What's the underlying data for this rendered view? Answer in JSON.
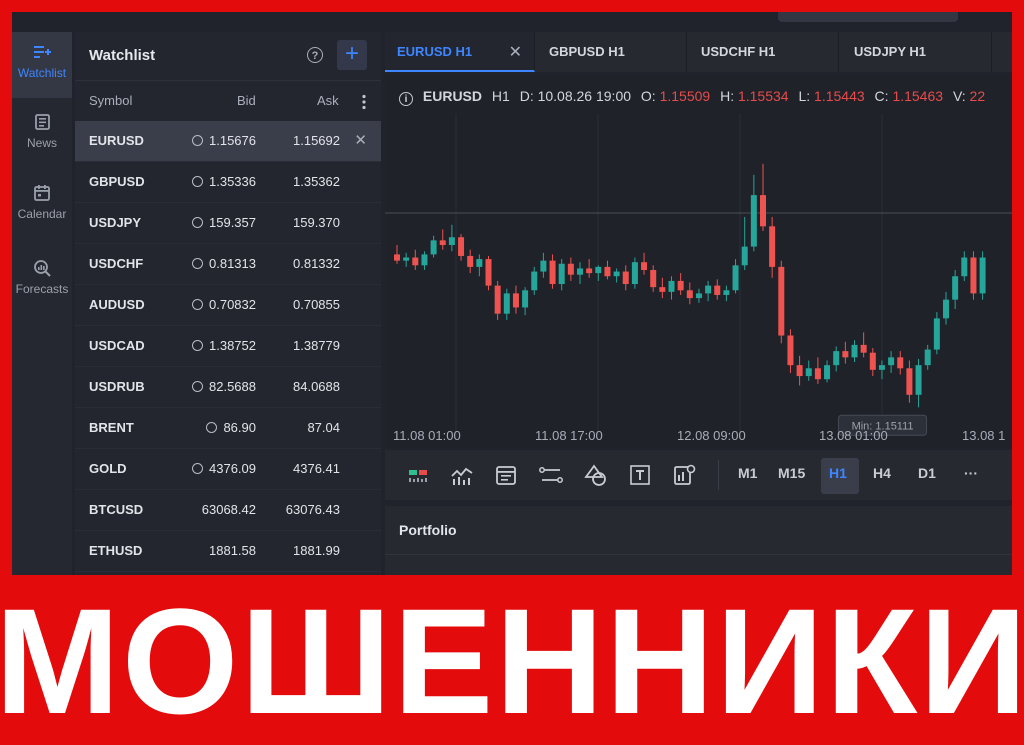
{
  "nav": {
    "items": [
      {
        "label": "Watchlist"
      },
      {
        "label": "News"
      },
      {
        "label": "Calendar"
      },
      {
        "label": "Forecasts"
      }
    ]
  },
  "watchlist": {
    "title": "Watchlist",
    "help_glyph": "?",
    "add_glyph": "+",
    "columns": {
      "symbol": "Symbol",
      "bid": "Bid",
      "ask": "Ask"
    },
    "rows": [
      {
        "symbol": "EURUSD",
        "bid": "1.15676",
        "ask": "1.15692",
        "alarm": true
      },
      {
        "symbol": "GBPUSD",
        "bid": "1.35336",
        "ask": "1.35362",
        "alarm": true
      },
      {
        "symbol": "USDJPY",
        "bid": "159.357",
        "ask": "159.370",
        "alarm": true
      },
      {
        "symbol": "USDCHF",
        "bid": "0.81313",
        "ask": "0.81332",
        "alarm": true
      },
      {
        "symbol": "AUDUSD",
        "bid": "0.70832",
        "ask": "0.70855",
        "alarm": true
      },
      {
        "symbol": "USDCAD",
        "bid": "1.38752",
        "ask": "1.38779",
        "alarm": true
      },
      {
        "symbol": "USDRUB",
        "bid": "82.5688",
        "ask": "84.0688",
        "alarm": true
      },
      {
        "symbol": "BRENT",
        "bid": "86.90",
        "ask": "87.04",
        "alarm": true
      },
      {
        "symbol": "GOLD",
        "bid": "4376.09",
        "ask": "4376.41",
        "alarm": true
      },
      {
        "symbol": "BTCUSD",
        "bid": "63068.42",
        "ask": "63076.43",
        "alarm": false
      },
      {
        "symbol": "ETHUSD",
        "bid": "1881.58",
        "ask": "1881.99",
        "alarm": false
      }
    ]
  },
  "tabs": [
    {
      "label": "EURUSD H1",
      "active": true
    },
    {
      "label": "GBPUSD H1"
    },
    {
      "label": "USDCHF H1"
    },
    {
      "label": "USDJPY H1"
    }
  ],
  "chart_header": {
    "symbol": "EURUSD",
    "timeframe": "H1",
    "date_label": "D:",
    "date": "10.08.26 19:00",
    "open_label": "O:",
    "open": "1.15509",
    "high_label": "H:",
    "high": "1.15534",
    "low_label": "L:",
    "low": "1.15443",
    "close_label": "C:",
    "close": "1.15463",
    "volume_label": "V:",
    "volume": "22"
  },
  "chart_data": {
    "type": "candlestick",
    "x_tick_labels": [
      "11.08 01:00",
      "11.08 17:00",
      "12.08 09:00",
      "13.08 01:00",
      "13.08 1"
    ],
    "annotation": "Min: 1.15111",
    "up_color": "#26a69a",
    "down_color": "#ef5350",
    "grid": true,
    "series": [
      {
        "o": 1.155,
        "h": 1.1556,
        "l": 1.1544,
        "c": 1.1546
      },
      {
        "o": 1.1546,
        "h": 1.1551,
        "l": 1.1542,
        "c": 1.1548
      },
      {
        "o": 1.1548,
        "h": 1.1553,
        "l": 1.154,
        "c": 1.1543
      },
      {
        "o": 1.1543,
        "h": 1.1552,
        "l": 1.154,
        "c": 1.155
      },
      {
        "o": 1.155,
        "h": 1.1562,
        "l": 1.1548,
        "c": 1.1559
      },
      {
        "o": 1.1559,
        "h": 1.1566,
        "l": 1.1553,
        "c": 1.1556
      },
      {
        "o": 1.1556,
        "h": 1.1569,
        "l": 1.1552,
        "c": 1.1561
      },
      {
        "o": 1.1561,
        "h": 1.1563,
        "l": 1.1546,
        "c": 1.1549
      },
      {
        "o": 1.1549,
        "h": 1.1553,
        "l": 1.1538,
        "c": 1.1542
      },
      {
        "o": 1.1542,
        "h": 1.155,
        "l": 1.1536,
        "c": 1.1547
      },
      {
        "o": 1.1547,
        "h": 1.1549,
        "l": 1.1527,
        "c": 1.153
      },
      {
        "o": 1.153,
        "h": 1.1533,
        "l": 1.1508,
        "c": 1.1512
      },
      {
        "o": 1.1512,
        "h": 1.1528,
        "l": 1.1508,
        "c": 1.1525
      },
      {
        "o": 1.1525,
        "h": 1.153,
        "l": 1.1512,
        "c": 1.1516
      },
      {
        "o": 1.1516,
        "h": 1.1529,
        "l": 1.1511,
        "c": 1.1527
      },
      {
        "o": 1.1527,
        "h": 1.1542,
        "l": 1.1524,
        "c": 1.1539
      },
      {
        "o": 1.1539,
        "h": 1.1551,
        "l": 1.1535,
        "c": 1.1546
      },
      {
        "o": 1.1546,
        "h": 1.155,
        "l": 1.1528,
        "c": 1.1531
      },
      {
        "o": 1.1531,
        "h": 1.1547,
        "l": 1.1527,
        "c": 1.1544
      },
      {
        "o": 1.1544,
        "h": 1.1548,
        "l": 1.1533,
        "c": 1.1537
      },
      {
        "o": 1.1537,
        "h": 1.1545,
        "l": 1.1531,
        "c": 1.1541
      },
      {
        "o": 1.1541,
        "h": 1.1547,
        "l": 1.1535,
        "c": 1.1538
      },
      {
        "o": 1.1538,
        "h": 1.1543,
        "l": 1.1533,
        "c": 1.1542
      },
      {
        "o": 1.1542,
        "h": 1.1546,
        "l": 1.1534,
        "c": 1.1536
      },
      {
        "o": 1.1536,
        "h": 1.1541,
        "l": 1.1532,
        "c": 1.1539
      },
      {
        "o": 1.1539,
        "h": 1.1543,
        "l": 1.1527,
        "c": 1.1531
      },
      {
        "o": 1.1531,
        "h": 1.1548,
        "l": 1.1528,
        "c": 1.1545
      },
      {
        "o": 1.1545,
        "h": 1.1551,
        "l": 1.1537,
        "c": 1.154
      },
      {
        "o": 1.154,
        "h": 1.1543,
        "l": 1.1526,
        "c": 1.1529
      },
      {
        "o": 1.1529,
        "h": 1.1535,
        "l": 1.1522,
        "c": 1.1526
      },
      {
        "o": 1.1526,
        "h": 1.1536,
        "l": 1.1521,
        "c": 1.1533
      },
      {
        "o": 1.1533,
        "h": 1.1538,
        "l": 1.1524,
        "c": 1.1527
      },
      {
        "o": 1.1527,
        "h": 1.1532,
        "l": 1.1518,
        "c": 1.1522
      },
      {
        "o": 1.1522,
        "h": 1.1528,
        "l": 1.1519,
        "c": 1.1525
      },
      {
        "o": 1.1525,
        "h": 1.1533,
        "l": 1.152,
        "c": 1.153
      },
      {
        "o": 1.153,
        "h": 1.1534,
        "l": 1.1521,
        "c": 1.1524
      },
      {
        "o": 1.1524,
        "h": 1.153,
        "l": 1.152,
        "c": 1.1527
      },
      {
        "o": 1.1527,
        "h": 1.1547,
        "l": 1.1525,
        "c": 1.1543
      },
      {
        "o": 1.1543,
        "h": 1.1574,
        "l": 1.154,
        "c": 1.1555
      },
      {
        "o": 1.1555,
        "h": 1.1601,
        "l": 1.1552,
        "c": 1.1588
      },
      {
        "o": 1.1588,
        "h": 1.1608,
        "l": 1.1565,
        "c": 1.1568
      },
      {
        "o": 1.1568,
        "h": 1.1574,
        "l": 1.1535,
        "c": 1.1542
      },
      {
        "o": 1.1542,
        "h": 1.1546,
        "l": 1.1493,
        "c": 1.1498
      },
      {
        "o": 1.1498,
        "h": 1.1502,
        "l": 1.1474,
        "c": 1.1479
      },
      {
        "o": 1.1479,
        "h": 1.1485,
        "l": 1.1466,
        "c": 1.1472
      },
      {
        "o": 1.1472,
        "h": 1.1482,
        "l": 1.1469,
        "c": 1.1477
      },
      {
        "o": 1.1477,
        "h": 1.1484,
        "l": 1.1467,
        "c": 1.147
      },
      {
        "o": 1.147,
        "h": 1.1482,
        "l": 1.1468,
        "c": 1.1479
      },
      {
        "o": 1.1479,
        "h": 1.1491,
        "l": 1.1475,
        "c": 1.1488
      },
      {
        "o": 1.1488,
        "h": 1.1494,
        "l": 1.148,
        "c": 1.1484
      },
      {
        "o": 1.1484,
        "h": 1.1495,
        "l": 1.1481,
        "c": 1.1492
      },
      {
        "o": 1.1492,
        "h": 1.15,
        "l": 1.1484,
        "c": 1.1487
      },
      {
        "o": 1.1487,
        "h": 1.149,
        "l": 1.1472,
        "c": 1.1476
      },
      {
        "o": 1.1476,
        "h": 1.1482,
        "l": 1.147,
        "c": 1.1479
      },
      {
        "o": 1.1479,
        "h": 1.1488,
        "l": 1.1474,
        "c": 1.1484
      },
      {
        "o": 1.1484,
        "h": 1.1488,
        "l": 1.1473,
        "c": 1.1477
      },
      {
        "o": 1.1477,
        "h": 1.1482,
        "l": 1.1455,
        "c": 1.146
      },
      {
        "o": 1.146,
        "h": 1.1483,
        "l": 1.1452,
        "c": 1.1479
      },
      {
        "o": 1.1479,
        "h": 1.1492,
        "l": 1.1476,
        "c": 1.1489
      },
      {
        "o": 1.1489,
        "h": 1.1513,
        "l": 1.1486,
        "c": 1.1509
      },
      {
        "o": 1.1509,
        "h": 1.1526,
        "l": 1.1505,
        "c": 1.1521
      },
      {
        "o": 1.1521,
        "h": 1.154,
        "l": 1.1515,
        "c": 1.1536
      },
      {
        "o": 1.1536,
        "h": 1.1552,
        "l": 1.1533,
        "c": 1.1548
      },
      {
        "o": 1.1548,
        "h": 1.1552,
        "l": 1.1521,
        "c": 1.1525
      },
      {
        "o": 1.1525,
        "h": 1.1552,
        "l": 1.1521,
        "c": 1.1548
      }
    ]
  },
  "toolbar": {
    "timeframes": [
      {
        "label": "M1"
      },
      {
        "label": "M15"
      },
      {
        "label": "H1",
        "active": true
      },
      {
        "label": "H4"
      },
      {
        "label": "D1"
      },
      {
        "label": "···"
      }
    ]
  },
  "portfolio": {
    "title": "Portfolio"
  },
  "banner": {
    "text": "МОШЕННИКИ"
  },
  "colors": {
    "accent": "#3d86ff",
    "banner": "#e30b0b",
    "price_red": "#e84b4b"
  }
}
